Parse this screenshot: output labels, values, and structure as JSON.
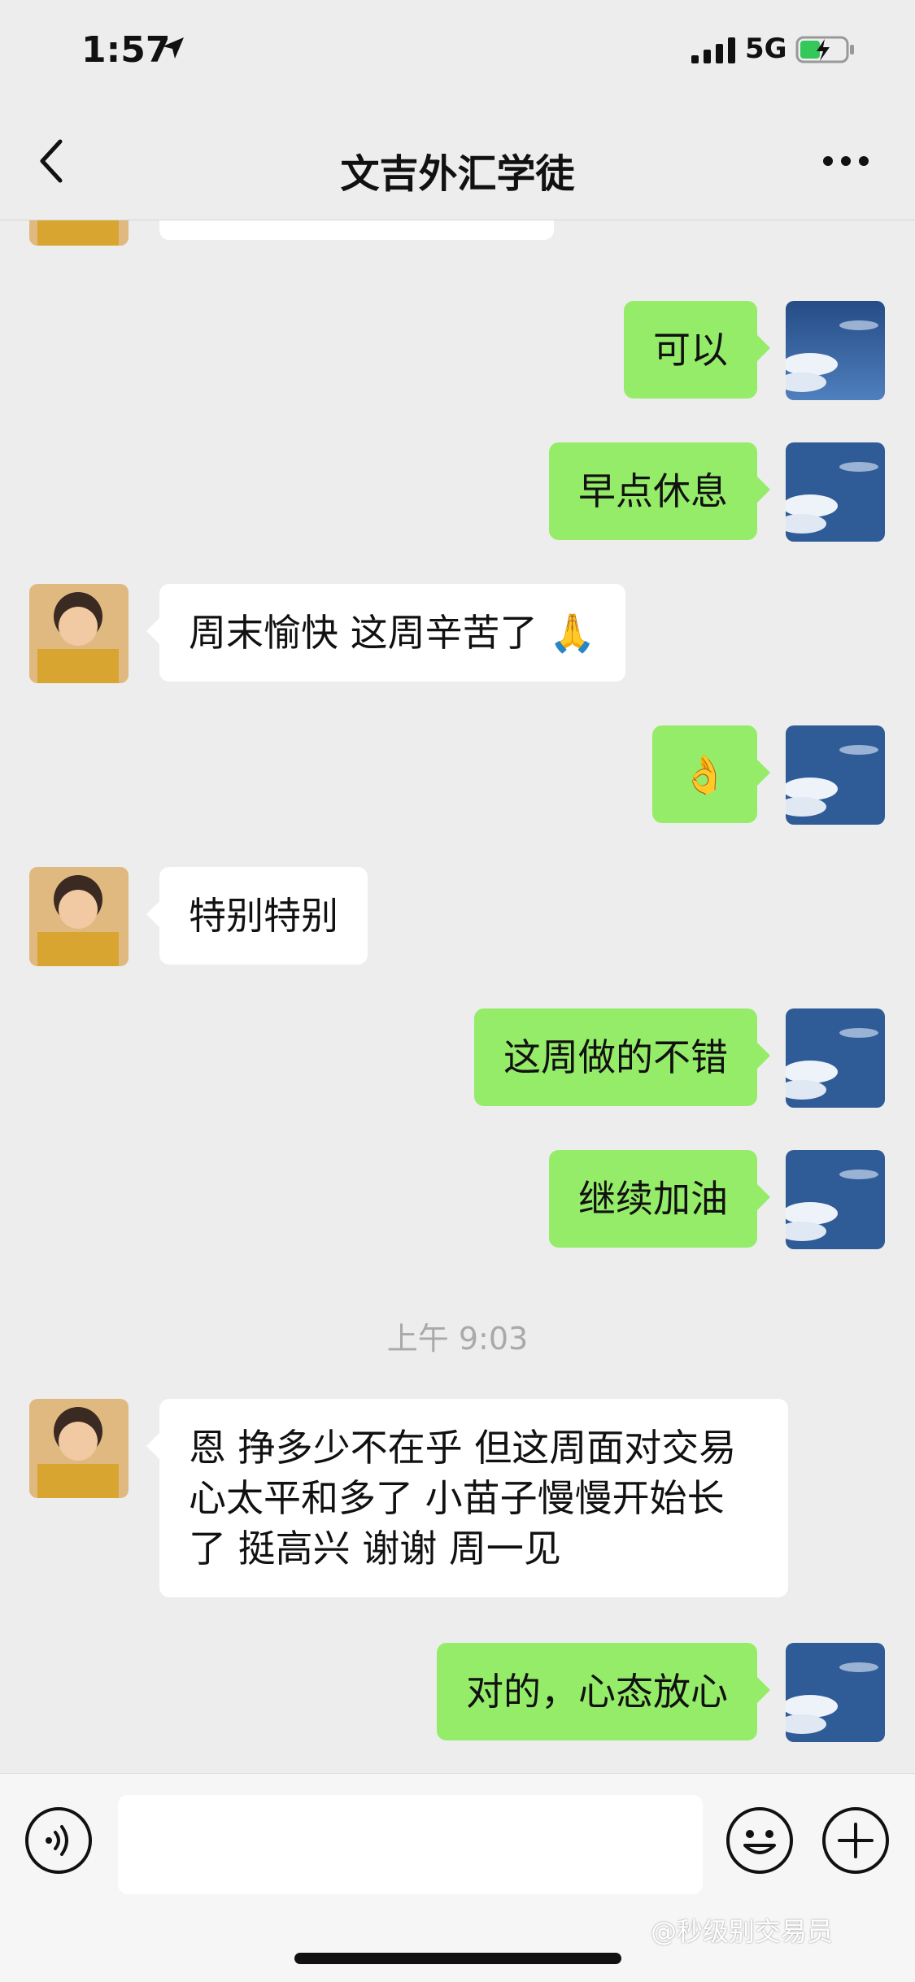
{
  "status_bar": {
    "time": "1:57",
    "network": "5G"
  },
  "header": {
    "title": "文吉外汇学徒"
  },
  "messages": {
    "m1": "可以",
    "m2": "早点休息",
    "m3": "周末愉快 这周辛苦了 🙏",
    "m4": "👌",
    "m5": "特别特别",
    "m6": "这周做的不错",
    "m7": "继续加油",
    "timestamp": "上午 9:03",
    "m8": "恩 挣多少不在乎 但这周面对交易心太平和多了 小苗子慢慢开始长了 挺高兴 谢谢 周一见",
    "m9": "对的，心态放心"
  },
  "input": {
    "value": ""
  },
  "watermark": "@秒级别交易员",
  "colors": {
    "self_bubble": "#95ec69",
    "other_bubble": "#ffffff",
    "background": "#ededed"
  }
}
